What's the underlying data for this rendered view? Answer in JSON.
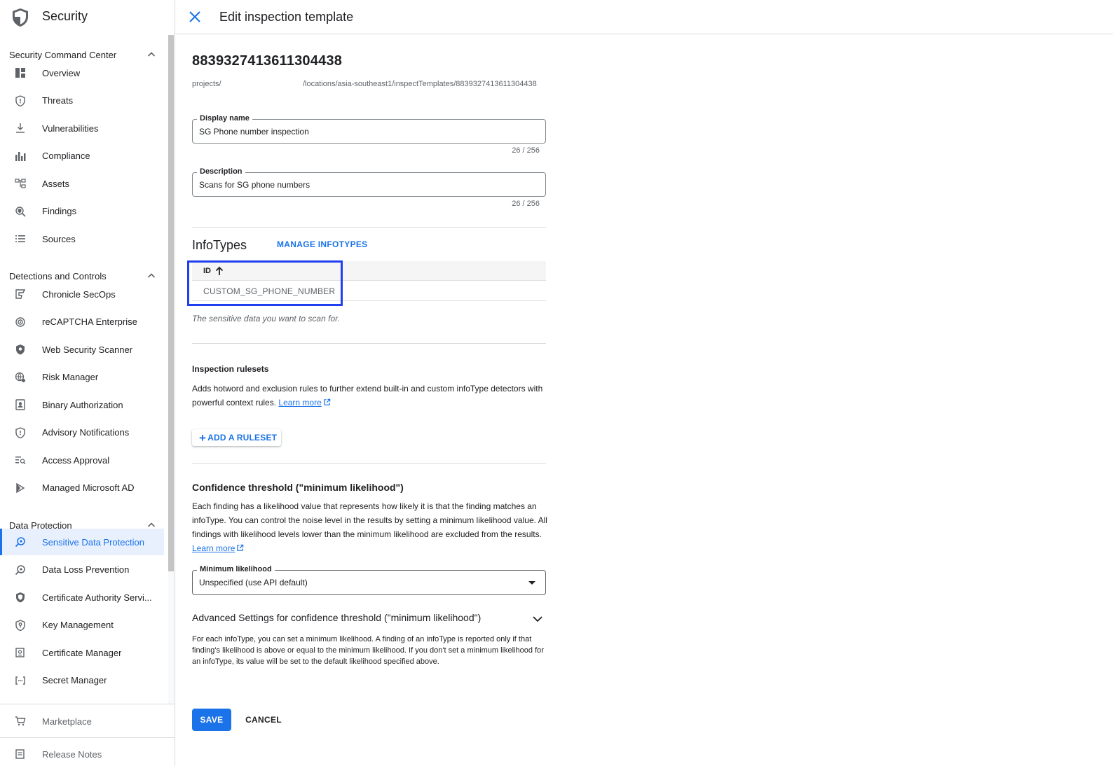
{
  "app": {
    "title": "Security"
  },
  "sidebar": {
    "sections": [
      {
        "title": "Security Command Center",
        "items": [
          {
            "label": "Overview",
            "icon": "dashboard-icon"
          },
          {
            "label": "Threats",
            "icon": "shield-icon"
          },
          {
            "label": "Vulnerabilities",
            "icon": "download-icon"
          },
          {
            "label": "Compliance",
            "icon": "bar-chart-icon"
          },
          {
            "label": "Assets",
            "icon": "hierarchy-icon"
          },
          {
            "label": "Findings",
            "icon": "search-shield-icon"
          },
          {
            "label": "Sources",
            "icon": "list-icon"
          }
        ]
      },
      {
        "title": "Detections and Controls",
        "items": [
          {
            "label": "Chronicle SecOps",
            "icon": "chronicle-icon"
          },
          {
            "label": "reCAPTCHA Enterprise",
            "icon": "recaptcha-icon"
          },
          {
            "label": "Web Security Scanner",
            "icon": "shield-filled-icon"
          },
          {
            "label": "Risk Manager",
            "icon": "globe-gear-icon"
          },
          {
            "label": "Binary Authorization",
            "icon": "badge-icon"
          },
          {
            "label": "Advisory Notifications",
            "icon": "shield-alert-icon"
          },
          {
            "label": "Access Approval",
            "icon": "list-search-icon"
          },
          {
            "label": "Managed Microsoft AD",
            "icon": "directory-icon"
          }
        ]
      },
      {
        "title": "Data Protection",
        "items": [
          {
            "label": "Sensitive Data Protection",
            "icon": "data-search-icon",
            "active": true
          },
          {
            "label": "Data Loss Prevention",
            "icon": "data-search-icon"
          },
          {
            "label": "Certificate Authority Servi...",
            "icon": "certificate-shield-icon"
          },
          {
            "label": "Key Management",
            "icon": "key-shield-icon"
          },
          {
            "label": "Certificate Manager",
            "icon": "certificate-icon"
          },
          {
            "label": "Secret Manager",
            "icon": "secret-icon"
          }
        ]
      }
    ],
    "bottom": [
      {
        "label": "Marketplace",
        "icon": "cart-icon"
      },
      {
        "label": "Release Notes",
        "icon": "notes-icon"
      }
    ]
  },
  "topbar": {
    "title": "Edit inspection template"
  },
  "template": {
    "id": "8839327413611304438",
    "path_prefix": "projects/",
    "path_suffix": "/locations/asia-southeast1/inspectTemplates/8839327413611304438"
  },
  "form": {
    "display_name": {
      "label": "Display name",
      "value": "SG Phone number inspection",
      "counter": "26 / 256"
    },
    "description": {
      "label": "Description",
      "value": "Scans for SG phone numbers",
      "counter": "26 / 256"
    }
  },
  "infotypes": {
    "title": "InfoTypes",
    "manage_label": "MANAGE INFOTYPES",
    "column_header": "ID",
    "rows": [
      "CUSTOM_SG_PHONE_NUMBER"
    ],
    "hint": "The sensitive data you want to scan for."
  },
  "rulesets": {
    "title": "Inspection rulesets",
    "text": "Adds hotword and exclusion rules to further extend built-in and custom infoType detectors with powerful context rules.",
    "learn_more": "Learn more",
    "add_label": "ADD A RULESET"
  },
  "confidence": {
    "title": "Confidence threshold (\"minimum likelihood\")",
    "text": "Each finding has a likelihood value that represents how likely it is that the finding matches an infoType. You can control the noise level in the results by setting a minimum likelihood value. All findings with likelihood levels lower than the minimum likelihood are excluded from the results.",
    "learn_more": "Learn more",
    "select_label": "Minimum likelihood",
    "select_value": "Unspecified (use API default)",
    "advanced_title": "Advanced Settings for confidence threshold (\"minimum likelihood\")",
    "advanced_text": "For each infoType, you can set a minimum likelihood. A finding of an infoType is reported only if that finding's likelihood is above or equal to the minimum likelihood. If you don't set a minimum likelihood for an infoType, its value will be set to the default likelihood specified above."
  },
  "actions": {
    "save": "SAVE",
    "cancel": "CANCEL"
  },
  "colors": {
    "accent": "#1a73e8",
    "highlight": "#1f3ff0"
  }
}
